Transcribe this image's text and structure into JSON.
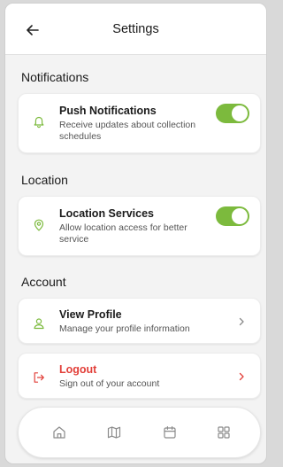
{
  "header": {
    "title": "Settings",
    "back_icon": "arrow-left-icon"
  },
  "colors": {
    "accent_green": "#7cba3d",
    "danger_red": "#e2403a"
  },
  "sections": {
    "notifications": {
      "title": "Notifications",
      "push": {
        "icon": "bell-icon",
        "title": "Push Notifications",
        "description": "Receive updates about collection schedules",
        "enabled": true
      }
    },
    "location": {
      "title": "Location",
      "services": {
        "icon": "map-pin-icon",
        "title": "Location Services",
        "description": "Allow location access for better service",
        "enabled": true
      }
    },
    "account": {
      "title": "Account",
      "profile": {
        "icon": "user-icon",
        "title": "View Profile",
        "description": "Manage your profile information"
      },
      "logout": {
        "icon": "logout-icon",
        "title": "Logout",
        "description": "Sign out of your account"
      }
    }
  },
  "bottom_nav": {
    "items": [
      "home-icon",
      "map-icon",
      "calendar-icon",
      "grid-icon"
    ]
  }
}
